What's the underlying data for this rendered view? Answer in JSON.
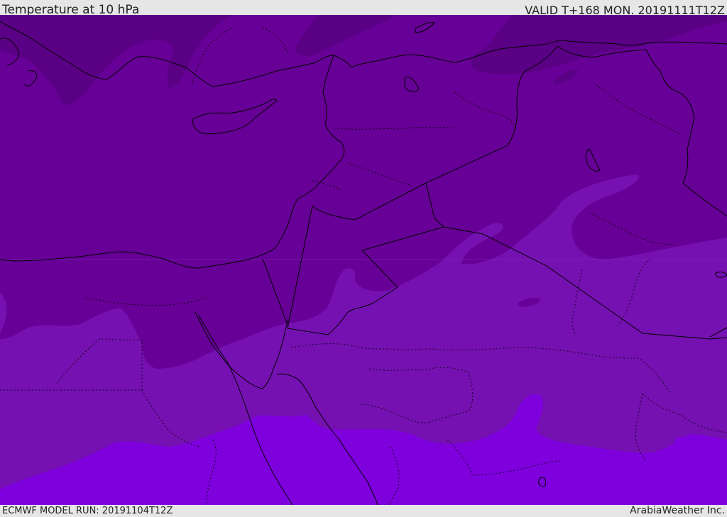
{
  "header": {
    "title": "Temperature at 10 hPa",
    "valid_time": "VALID T+168 MON. 20191111T12Z"
  },
  "footer": {
    "model_run": "ECMWF MODEL RUN: 20191104T12Z",
    "credit": "ArabiaWeather Inc."
  },
  "map": {
    "colors": {
      "darkest": "#5a0085",
      "dark": "#670096",
      "mid": "#7511b1",
      "light": "#7e00dd",
      "border": "#000000"
    }
  }
}
